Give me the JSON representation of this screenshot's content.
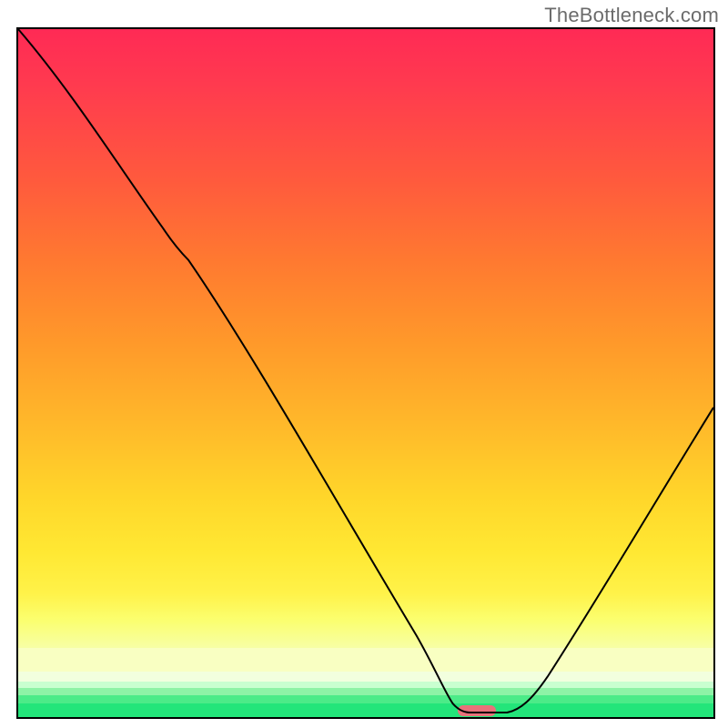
{
  "watermark": {
    "text": "TheBottleneck.com"
  },
  "chart_data": {
    "type": "line",
    "title": "",
    "xlabel": "",
    "ylabel": "",
    "xlim": [
      0,
      1
    ],
    "ylim": [
      0,
      100
    ],
    "x": [
      0.0,
      0.05,
      0.1,
      0.15,
      0.2,
      0.25,
      0.3,
      0.35,
      0.4,
      0.45,
      0.5,
      0.55,
      0.6,
      0.63,
      0.67,
      0.7,
      0.75,
      0.8,
      0.85,
      0.9,
      0.95,
      1.0
    ],
    "values": [
      100,
      94,
      87,
      80,
      73,
      68,
      60,
      52,
      44,
      36,
      28,
      19,
      10,
      3,
      0,
      0,
      5,
      13,
      22,
      30,
      38,
      46
    ],
    "background_gradient": {
      "type": "rainbow_vertical",
      "top": "#ff2a55",
      "mid_upper": "#ff8a2a",
      "mid": "#ffe12a",
      "mid_lower": "#f4ff66",
      "bottom_band_yellow": "#f7ffb0",
      "bottom_band_green": "#23e57a"
    },
    "marker": {
      "x_frac": 0.66,
      "y_frac": 0.992,
      "color": "#e9717a"
    }
  }
}
